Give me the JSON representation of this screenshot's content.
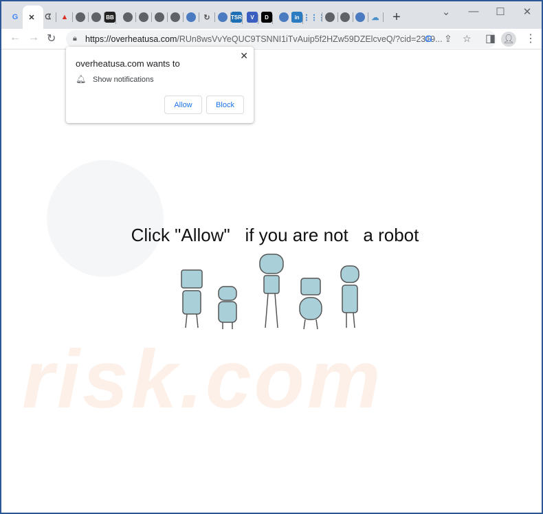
{
  "browser": {
    "tabs": [
      "google-icon",
      "close-icon",
      "pacman-icon",
      "warning-icon",
      "globe-icon",
      "globe-icon",
      "bb-icon",
      "globe-icon",
      "globe-icon",
      "globe-icon",
      "globe-icon",
      "yoku-icon",
      "refresh-icon",
      "chat-icon",
      "tsr-icon",
      "v-icon",
      "d-icon",
      "book-icon",
      "linkedin-icon",
      "grid-icon",
      "globe-icon",
      "globe-icon",
      "app-icon",
      "cloud-icon"
    ],
    "bb_label": "BB",
    "linkedin_label": "in",
    "d_label": "D",
    "v_label": "V",
    "tsr_label": "TSR",
    "new_tab": "+",
    "url_host": "https://overheatusa.com",
    "url_rest": "/RUn8wsVvYeQUC9TSNNI1iTvAuip5f2HZw59DZElcveQ/?cid=2319..."
  },
  "popup": {
    "title": "overheatusa.com wants to",
    "permission": "Show notifications",
    "allow": "Allow",
    "block": "Block",
    "close": "✕"
  },
  "page": {
    "headline": "Click \"Allow\"   if you are not   a robot",
    "watermark": "risk.com"
  },
  "colors": {
    "frame": "#2b5797",
    "accent": "#1a73e8",
    "robot": "#a9cfd8"
  }
}
